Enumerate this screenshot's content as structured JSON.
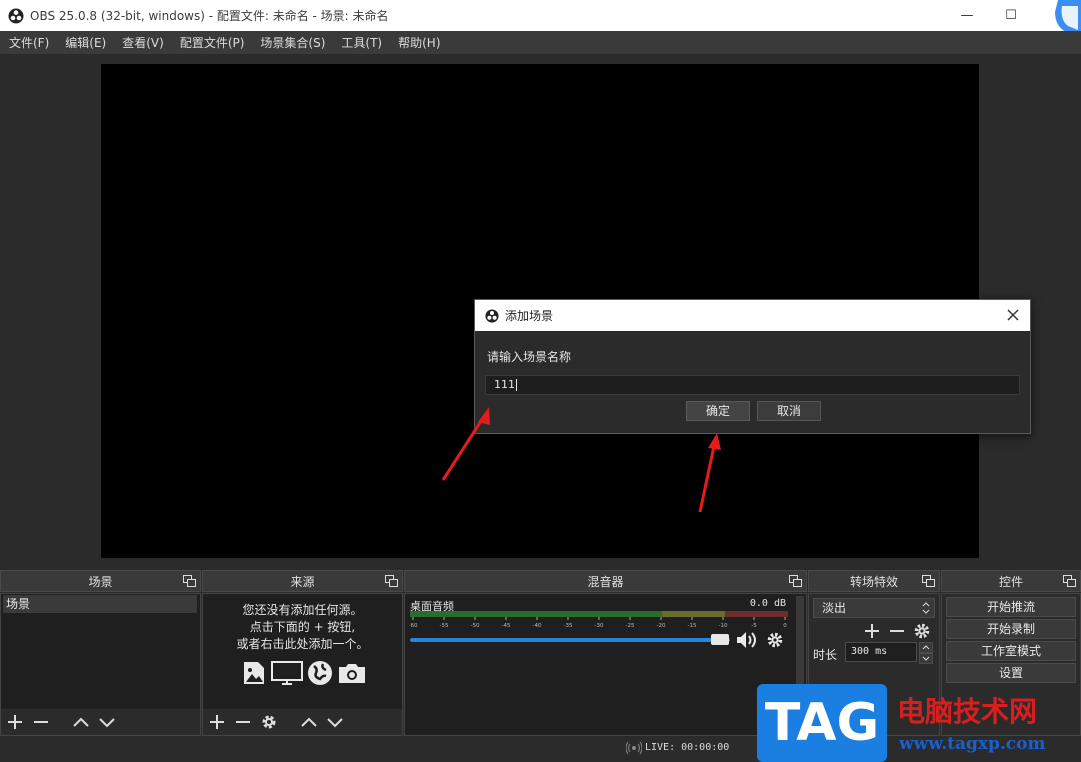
{
  "window": {
    "title": "OBS 25.0.8 (32-bit, windows) - 配置文件: 未命名 - 场景: 未命名",
    "minimize_glyph": "—",
    "maximize_glyph": "☐"
  },
  "menu": [
    "文件(F)",
    "编辑(E)",
    "查看(V)",
    "配置文件(P)",
    "场景集合(S)",
    "工具(T)",
    "帮助(H)"
  ],
  "docks": {
    "scenes": {
      "title": "场景",
      "items": [
        "场景"
      ]
    },
    "sources": {
      "title": "来源",
      "empty_line1": "您还没有添加任何源。",
      "empty_line2": "点击下面的 + 按钮,",
      "empty_line3": "或者右击此处添加一个。"
    },
    "mixer": {
      "title": "混音器",
      "track_name": "桌面音频",
      "level": "0.0 dB",
      "ticks": [
        "-60",
        "-55",
        "-50",
        "-45",
        "-40",
        "-35",
        "-30",
        "-25",
        "-20",
        "-15",
        "-10",
        "-5",
        "0"
      ]
    },
    "transitions": {
      "title": "转场特效",
      "selected": "淡出",
      "duration_label": "时长",
      "duration_value": "300 ms"
    },
    "controls": {
      "title": "控件",
      "start_stream": "开始推流",
      "start_record": "开始录制",
      "studio_mode": "工作室模式",
      "settings": "设置"
    }
  },
  "status": {
    "live": "LIVE: 00:00:00"
  },
  "dialog": {
    "title": "添加场景",
    "prompt": "请输入场景名称",
    "input_value": "111",
    "ok_label": "确定",
    "cancel_label": "取消"
  },
  "watermark": {
    "tag": "TAG",
    "cn_text": "电脑技术网",
    "url": "www.tagxp.com"
  },
  "colors": {
    "accent_blue": "#2a82da",
    "arrow_red": "#e51c1c",
    "watermark_blue": "#1a7fe0",
    "watermark_red": "#d91e1e"
  }
}
